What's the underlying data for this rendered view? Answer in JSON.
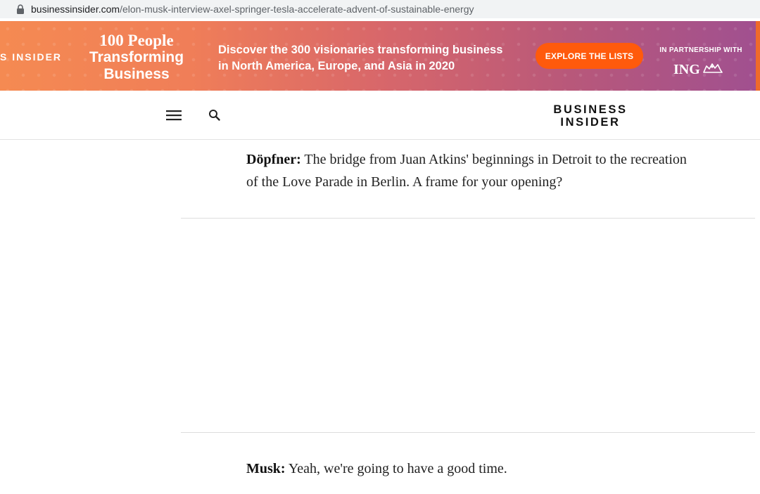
{
  "browser": {
    "url_domain": "businessinsider.com",
    "url_path": "/elon-musk-interview-axel-springer-tesla-accelerate-advent-of-sustainable-energy"
  },
  "banner": {
    "brand_partial": "S INSIDER",
    "title_line1": "100 People",
    "title_line2": "Transforming",
    "title_line3": "Business",
    "tagline_line1": "Discover the 300 visionaries transforming business",
    "tagline_line2": "in North America, Europe, and Asia in 2020",
    "cta_label": "EXPLORE THE LISTS",
    "partner_label": "IN PARTNERSHIP WITH",
    "partner_name": "ING",
    "accent_color": "#ff5a0c"
  },
  "header": {
    "logo_line1": "BUSINESS",
    "logo_line2": "INSIDER",
    "menu_icon": "hamburger-menu-icon",
    "search_icon": "search-icon"
  },
  "article": {
    "paragraphs": [
      {
        "speaker": "Döpfner:",
        "text": " The bridge from Juan Atkins' beginnings in Detroit to the recreation of the Love Parade in Berlin. A frame for your opening?"
      },
      {
        "speaker": "Musk:",
        "text": " Yeah, we're going to have a good time."
      }
    ]
  }
}
